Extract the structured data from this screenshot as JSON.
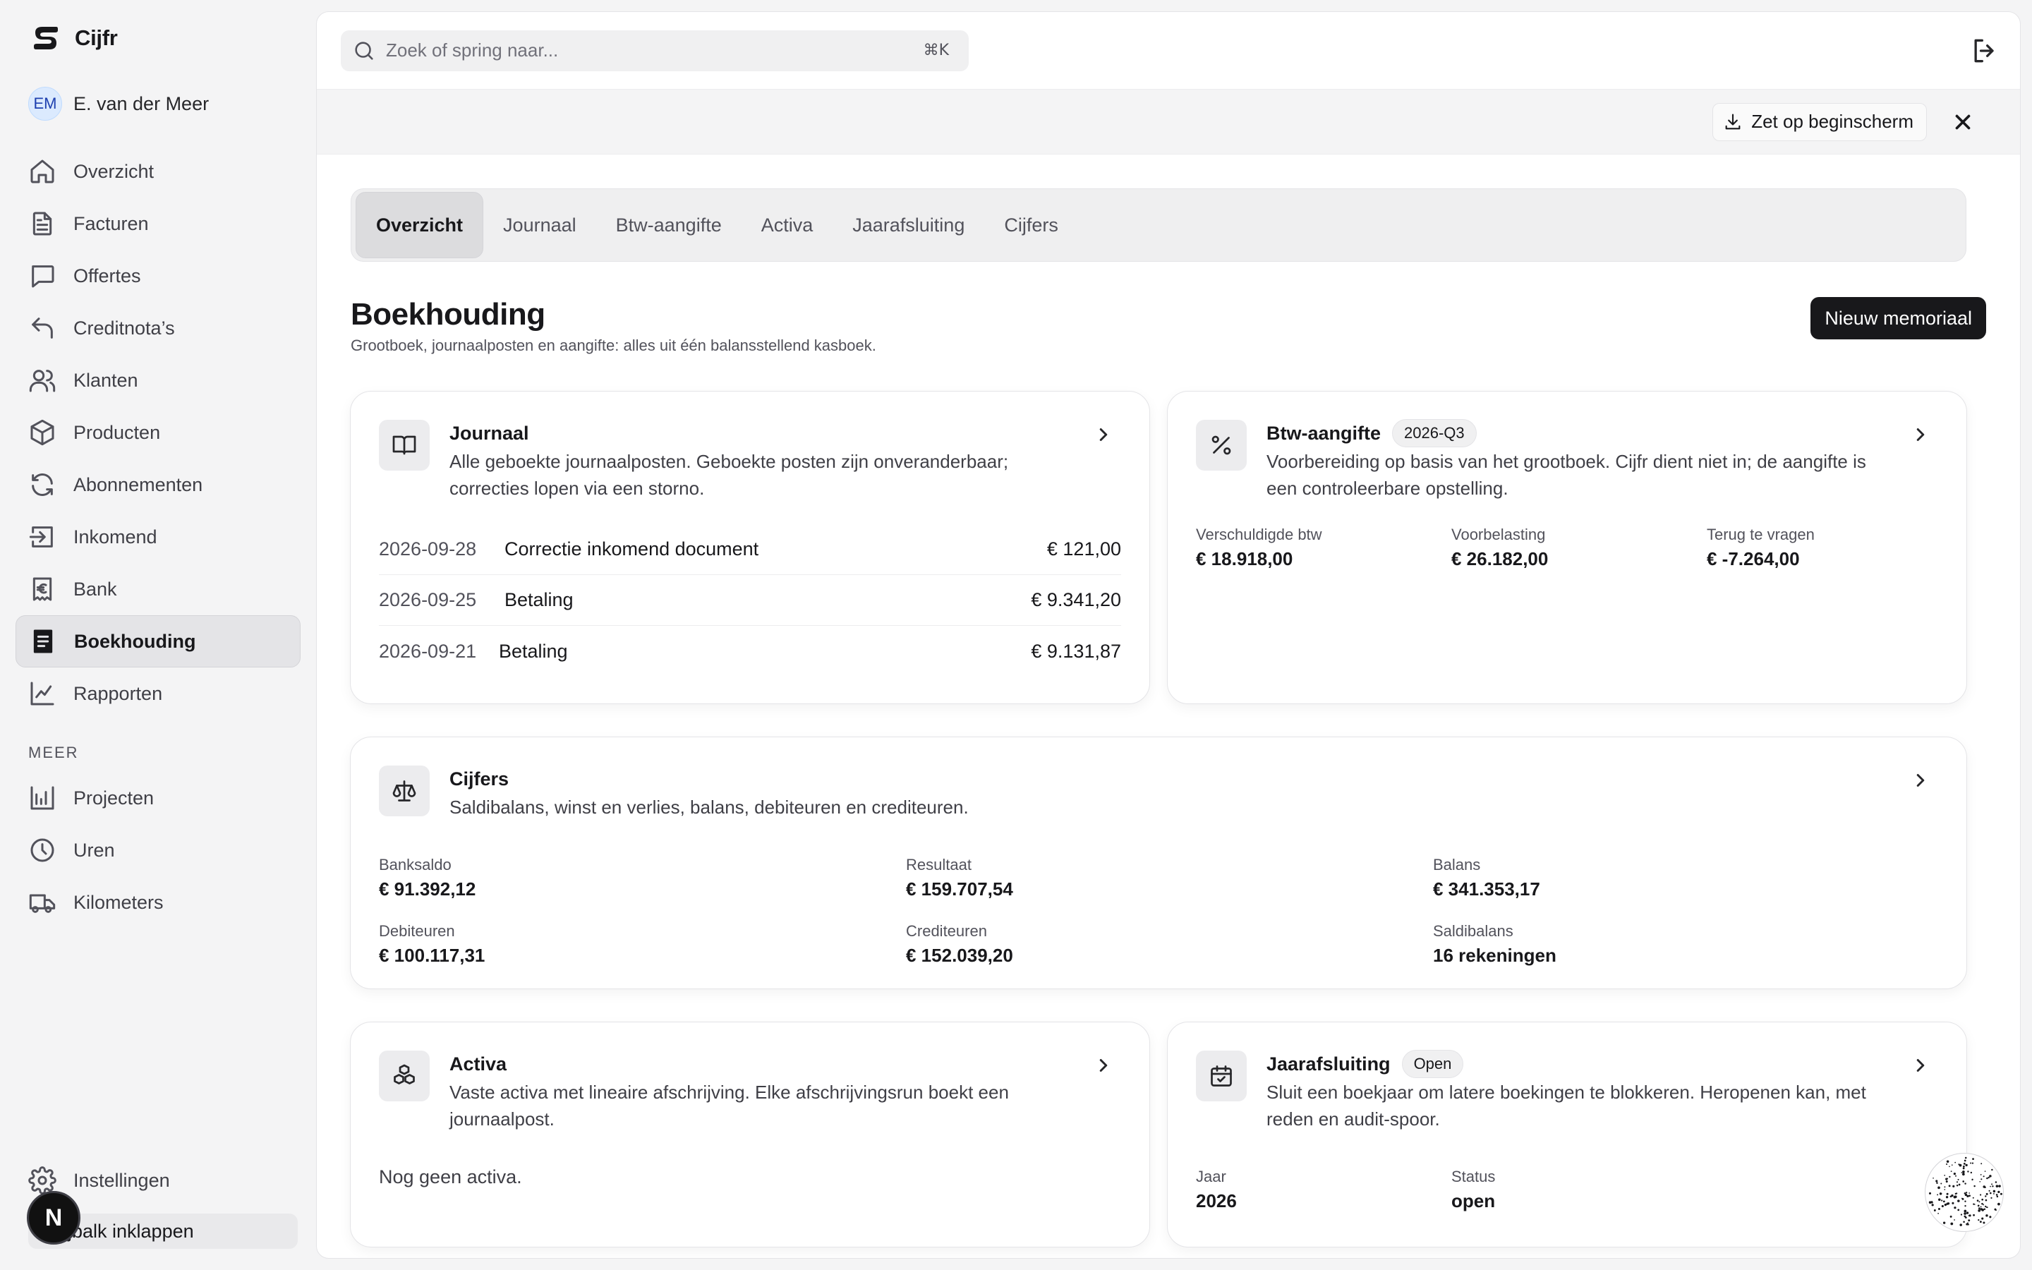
{
  "app": {
    "name": "Cijfr"
  },
  "user": {
    "initials": "EM",
    "name": "E. van der Meer"
  },
  "sidebar": {
    "items": [
      {
        "label": "Overzicht",
        "icon": "home-icon"
      },
      {
        "label": "Facturen",
        "icon": "document-icon"
      },
      {
        "label": "Offertes",
        "icon": "message-icon"
      },
      {
        "label": "Creditnota’s",
        "icon": "undo-icon"
      },
      {
        "label": "Klanten",
        "icon": "users-icon"
      },
      {
        "label": "Producten",
        "icon": "box-icon"
      },
      {
        "label": "Abonnementen",
        "icon": "refresh-icon"
      },
      {
        "label": "Inkomend",
        "icon": "inbox-in-icon"
      },
      {
        "label": "Bank",
        "icon": "euro-icon"
      },
      {
        "label": "Boekhouding",
        "icon": "ledger-icon",
        "active": true
      },
      {
        "label": "Rapporten",
        "icon": "line-chart-icon"
      }
    ],
    "section_more": "MEER",
    "more_items": [
      {
        "label": "Projecten",
        "icon": "project-chart-icon"
      },
      {
        "label": "Uren",
        "icon": "clock-icon"
      },
      {
        "label": "Kilometers",
        "icon": "truck-icon"
      }
    ],
    "settings_label": "Instellingen",
    "collapse_label": "ijbalk inklappen",
    "n_badge": "N"
  },
  "topbar": {
    "search_placeholder": "Zoek of spring naar...",
    "search_shortcut": "⌘K"
  },
  "install_bar": {
    "button_label": "Zet op beginscherm"
  },
  "tabs": [
    {
      "label": "Overzicht",
      "active": true
    },
    {
      "label": "Journaal"
    },
    {
      "label": "Btw-aangifte"
    },
    {
      "label": "Activa"
    },
    {
      "label": "Jaarafsluiting"
    },
    {
      "label": "Cijfers"
    }
  ],
  "page": {
    "title": "Boekhouding",
    "subtitle": "Grootboek, journaalposten en aangifte: alles uit één balansstellend kasboek.",
    "primary_button": "Nieuw memoriaal"
  },
  "cards": {
    "journaal": {
      "title": "Journaal",
      "description": "Alle geboekte journaalposten. Geboekte posten zijn onveranderbaar; correcties lopen via een storno.",
      "rows": [
        {
          "date": "2026-09-28",
          "description": "Correctie inkomend document",
          "amount": "€ 121,00"
        },
        {
          "date": "2026-09-25",
          "description": "Betaling",
          "amount": "€ 9.341,20"
        },
        {
          "date": "2026-09-21",
          "description": "Betaling",
          "amount": "€ 9.131,87"
        }
      ]
    },
    "btw": {
      "title": "Btw-aangifte",
      "badge": "2026-Q3",
      "description": "Voorbereiding op basis van het grootboek. Cijfr dient niet in; de aangifte is een controleerbare opstelling.",
      "metrics": [
        {
          "label": "Verschuldigde btw",
          "value": "€ 18.918,00"
        },
        {
          "label": "Voorbelasting",
          "value": "€ 26.182,00"
        },
        {
          "label": "Terug te vragen",
          "value": "€ -7.264,00"
        }
      ]
    },
    "cijfers": {
      "title": "Cijfers",
      "description": "Saldibalans, winst en verlies, balans, debiteuren en crediteuren.",
      "metrics": [
        {
          "label": "Banksaldo",
          "value": "€ 91.392,12"
        },
        {
          "label": "Resultaat",
          "value": "€ 159.707,54"
        },
        {
          "label": "Balans",
          "value": "€ 341.353,17"
        },
        {
          "label": "Debiteuren",
          "value": "€ 100.117,31"
        },
        {
          "label": "Crediteuren",
          "value": "€ 152.039,20"
        },
        {
          "label": "Saldibalans",
          "value": "16 rekeningen"
        }
      ]
    },
    "activa": {
      "title": "Activa",
      "description": "Vaste activa met lineaire afschrijving. Elke afschrijvingsrun boekt een journaalpost.",
      "empty": "Nog geen activa."
    },
    "jaarafsluiting": {
      "title": "Jaarafsluiting",
      "badge": "Open",
      "description": "Sluit een boekjaar om latere boekingen te blokkeren. Heropenen kan, met reden en audit-spoor.",
      "metrics": [
        {
          "label": "Jaar",
          "value": "2026"
        },
        {
          "label": "Status",
          "value": "open"
        }
      ]
    }
  }
}
